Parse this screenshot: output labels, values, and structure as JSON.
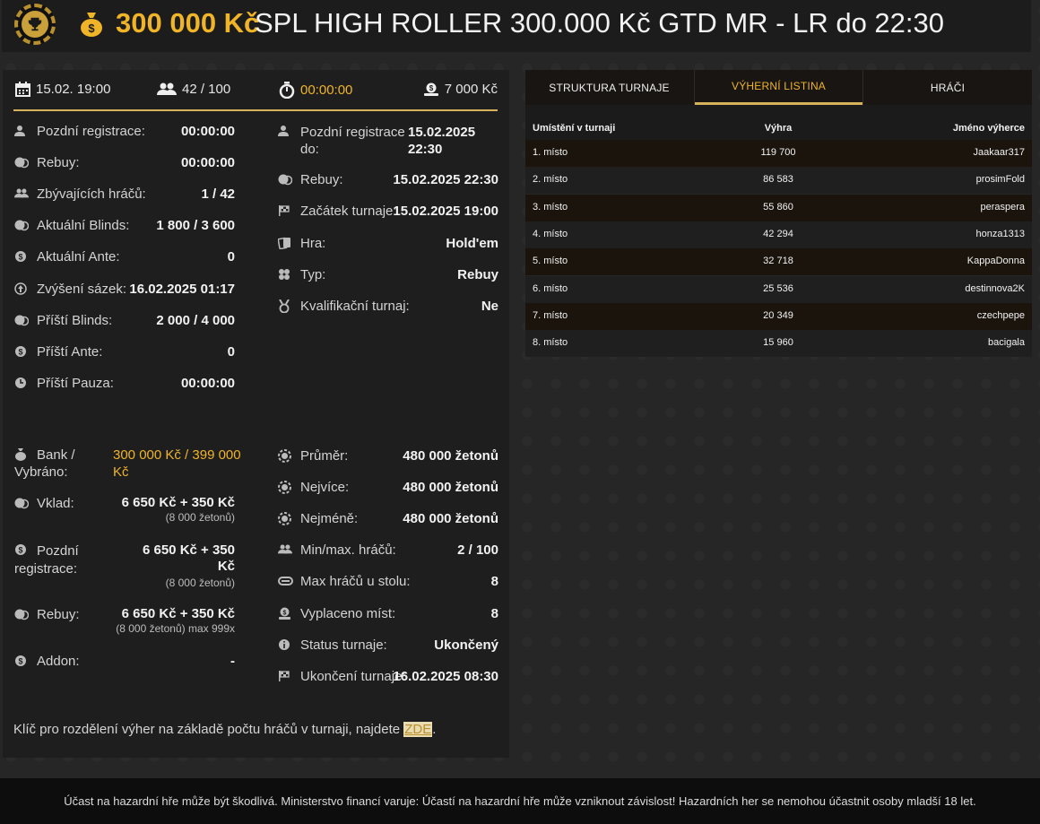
{
  "header": {
    "amount": "300 000 Kč",
    "title": "SPL HIGH ROLLER 300.000 Kč GTD MR - LR do 22:30"
  },
  "summary": {
    "date": "15.02. 19:00",
    "players": "42 / 100",
    "timer": "00:00:00",
    "buyin": "7 000 Kč"
  },
  "left_col": [
    {
      "icon": "user-clock-icon",
      "label": "Pozdní registrace:",
      "value": "00:00:00"
    },
    {
      "icon": "coins-icon",
      "label": "Rebuy:",
      "value": "00:00:00"
    },
    {
      "icon": "users-icon",
      "label": "Zbývajících hráčů:",
      "value": "1 / 42"
    },
    {
      "icon": "coins-icon",
      "label": "Aktuální Blinds:",
      "value": "1 800 / 3 600"
    },
    {
      "icon": "dollar-circle-icon",
      "label": "Aktuální Ante:",
      "value": "0"
    },
    {
      "icon": "arrow-up-circle-icon",
      "label": "Zvýšení sázek:",
      "value": "16.02.2025 01:17"
    },
    {
      "icon": "coins-icon",
      "label": "Příští Blinds:",
      "value": "2 000 / 4 000"
    },
    {
      "icon": "dollar-circle-icon",
      "label": "Příští Ante:",
      "value": "0"
    },
    {
      "icon": "clock-icon",
      "label": "Příští Pauza:",
      "value": "00:00:00"
    }
  ],
  "right_col": {
    "late_reg_label_1": "Pozdní registrace",
    "late_reg_label_2": "do:",
    "late_reg_value_1": "15.02.2025",
    "late_reg_value_2": "22:30",
    "rows": [
      {
        "icon": "coins-icon",
        "label": "Rebuy:",
        "value": "15.02.2025 22:30"
      },
      {
        "icon": "flag-icon",
        "label": "Začátek turnaje:",
        "value": "15.02.2025 19:00"
      },
      {
        "icon": "cards-icon",
        "label": "Hra:",
        "value": "Hold'em"
      },
      {
        "icon": "clubs-icon",
        "label": "Typ:",
        "value": "Rebuy"
      },
      {
        "icon": "medal-icon",
        "label": "Kvalifikační turnaj:",
        "value": "Ne"
      }
    ]
  },
  "money": {
    "bank_label_1": "Bank /",
    "bank_label_2": "Vybráno:",
    "bank_value_1": "300 000 Kč / 399 000",
    "bank_value_2": "Kč",
    "vklad_label": "Vklad:",
    "vklad_value": "6 650 Kč + 350 Kč",
    "vklad_sub": "(8 000 žetonů)",
    "late_label_1": "Pozdní",
    "late_label_2": "registrace:",
    "late_value_1": "6 650 Kč + 350",
    "late_value_2": "Kč",
    "late_sub": "(8 000 žetonů)",
    "rebuy_label": "Rebuy:",
    "rebuy_value": "6 650 Kč + 350 Kč",
    "rebuy_sub": "(8 000 žetonů) max 999x",
    "addon_label": "Addon:",
    "addon_value": "-"
  },
  "stats": [
    {
      "icon": "chip-icon",
      "label": "Průměr:",
      "value": "480 000 žetonů"
    },
    {
      "icon": "chip-icon",
      "label": "Nejvíce:",
      "value": "480 000 žetonů"
    },
    {
      "icon": "chip-icon",
      "label": "Nejméně:",
      "value": "480 000 žetonů"
    },
    {
      "icon": "users-icon",
      "label": "Min/max. hráčů:",
      "value": "2 / 100"
    },
    {
      "icon": "table-icon",
      "label": "Max hráčů u stolu:",
      "value": "8"
    },
    {
      "icon": "payout-icon",
      "label": "Vyplaceno míst:",
      "value": "8"
    },
    {
      "icon": "info-icon",
      "label": "Status turnaje:",
      "value": "Ukončený"
    },
    {
      "icon": "flag-icon",
      "label": "Ukončení turnaje:",
      "value": "16.02.2025 08:30"
    }
  ],
  "note": {
    "text": "Klíč pro rozdělení výher na základě počtu hráčů v turnaji, najdete ",
    "link": "ZDE",
    "end": "."
  },
  "tabs": [
    {
      "label": "STRUKTURA TURNAJE",
      "active": false
    },
    {
      "label": "VÝHERNÍ LISTINA",
      "active": true
    },
    {
      "label": "HRÁČI",
      "active": false
    }
  ],
  "payout_table": {
    "headers": [
      "Umístění v turnaji",
      "Výhra",
      "Jméno výherce"
    ],
    "rows": [
      [
        "1. místo",
        "119 700",
        "Jaakaar317"
      ],
      [
        "2. místo",
        "86 583",
        "prosimFold"
      ],
      [
        "3. místo",
        "55 860",
        "peraspera"
      ],
      [
        "4. místo",
        "42 294",
        "honza1313"
      ],
      [
        "5. místo",
        "32 718",
        "KappaDonna"
      ],
      [
        "6. místo",
        "25 536",
        "destinnova2K"
      ],
      [
        "7. místo",
        "20 349",
        "czechpepe"
      ],
      [
        "8. místo",
        "15 960",
        "bacigala"
      ]
    ]
  },
  "disclaimer": "Účast na hazardní hře může být škodlivá. Ministerstvo financí varuje: Účastí na hazardní hře může vzniknout závislost! Hazardních her se nemohou účastnit osoby mladší 18 let.",
  "colors": {
    "accent": "#f0b429",
    "panel": "#1e1e1e",
    "background": "#262626"
  }
}
